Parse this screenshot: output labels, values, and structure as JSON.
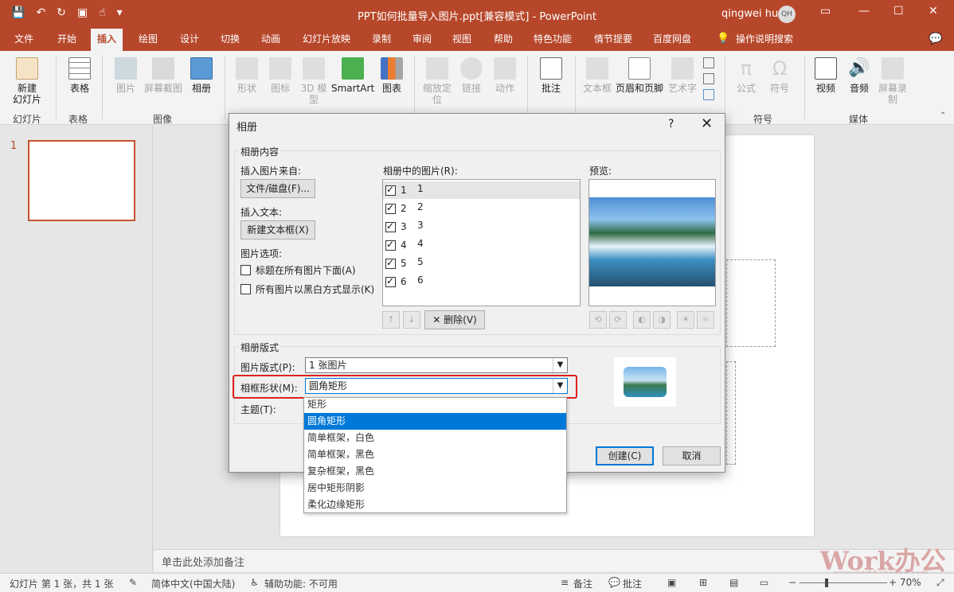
{
  "window": {
    "title": "PPT如何批量导入图片.ppt[兼容模式] - PowerPoint",
    "user": "qingwei hu",
    "avatar_initials": "QH",
    "accent": "#b7472a"
  },
  "tabs": [
    "文件",
    "开始",
    "插入",
    "绘图",
    "设计",
    "切换",
    "动画",
    "幻灯片放映",
    "录制",
    "审阅",
    "视图",
    "帮助",
    "特色功能",
    "情节提要",
    "百度网盘"
  ],
  "tell_me": "操作说明搜索",
  "ribbon": {
    "new_slide": "新建\n幻灯片",
    "table": "表格",
    "picture": "图片",
    "screenshot": "屏幕截图",
    "album": "相册",
    "shapes": "形状",
    "icons": "图标",
    "model3d": "3D 模型",
    "smartart": "SmartArt",
    "chart": "图表",
    "zoom": "缩放定位",
    "link": "链接",
    "action": "动作",
    "comment": "批注",
    "textbox": "文本框",
    "header_footer": "页眉和页脚",
    "wordart": "艺术字",
    "equation": "公式",
    "symbol": "符号",
    "video": "视频",
    "audio": "音频",
    "screen_record": "屏幕录制",
    "groups": {
      "slides": "幻灯片",
      "tables": "表格",
      "images": "图像",
      "symbols": "符号",
      "media": "媒体"
    }
  },
  "thumbs": {
    "slide_number": "1"
  },
  "notes_placeholder": "单击此处添加备注",
  "watermark": {
    "brand": "Work办公",
    "url": "www.workbangong.com"
  },
  "statusbar": {
    "slide_info": "幻灯片 第 1 张，共 1 张",
    "language": "简体中文(中国大陆)",
    "accessibility": "辅助功能: 不可用",
    "notes": "备注",
    "comments": "批注",
    "zoom": "70%"
  },
  "dialog": {
    "title": "相册",
    "help": "?",
    "album_content": "相册内容",
    "insert_from": "插入图片来自:",
    "file_disk_btn": "文件/磁盘(F)...",
    "insert_text": "插入文本:",
    "new_textbox_btn": "新建文本框(X)",
    "picture_options": "图片选项:",
    "caption_below": "标题在所有图片下面(A)",
    "black_white": "所有图片以黑白方式显示(K)",
    "pictures_in_album": "相册中的图片(R):",
    "pictures": [
      {
        "n": "1",
        "name": "1"
      },
      {
        "n": "2",
        "name": "2"
      },
      {
        "n": "3",
        "name": "3"
      },
      {
        "n": "4",
        "name": "4"
      },
      {
        "n": "5",
        "name": "5"
      },
      {
        "n": "6",
        "name": "6"
      }
    ],
    "delete_btn": "删除(V)",
    "preview": "预览:",
    "album_layout": "相册版式",
    "picture_layout_label": "图片版式(P):",
    "picture_layout_value": "1 张图片",
    "frame_shape_label": "相框形状(M):",
    "frame_shape_value": "圆角矩形",
    "theme_label": "主题(T):",
    "create_btn": "创建(C)",
    "cancel_btn": "取消",
    "frame_options": [
      "矩形",
      "圆角矩形",
      "简单框架，白色",
      "简单框架，黑色",
      "复杂框架，黑色",
      "居中矩形阴影",
      "柔化边缘矩形"
    ],
    "selected_frame_index": 1
  }
}
